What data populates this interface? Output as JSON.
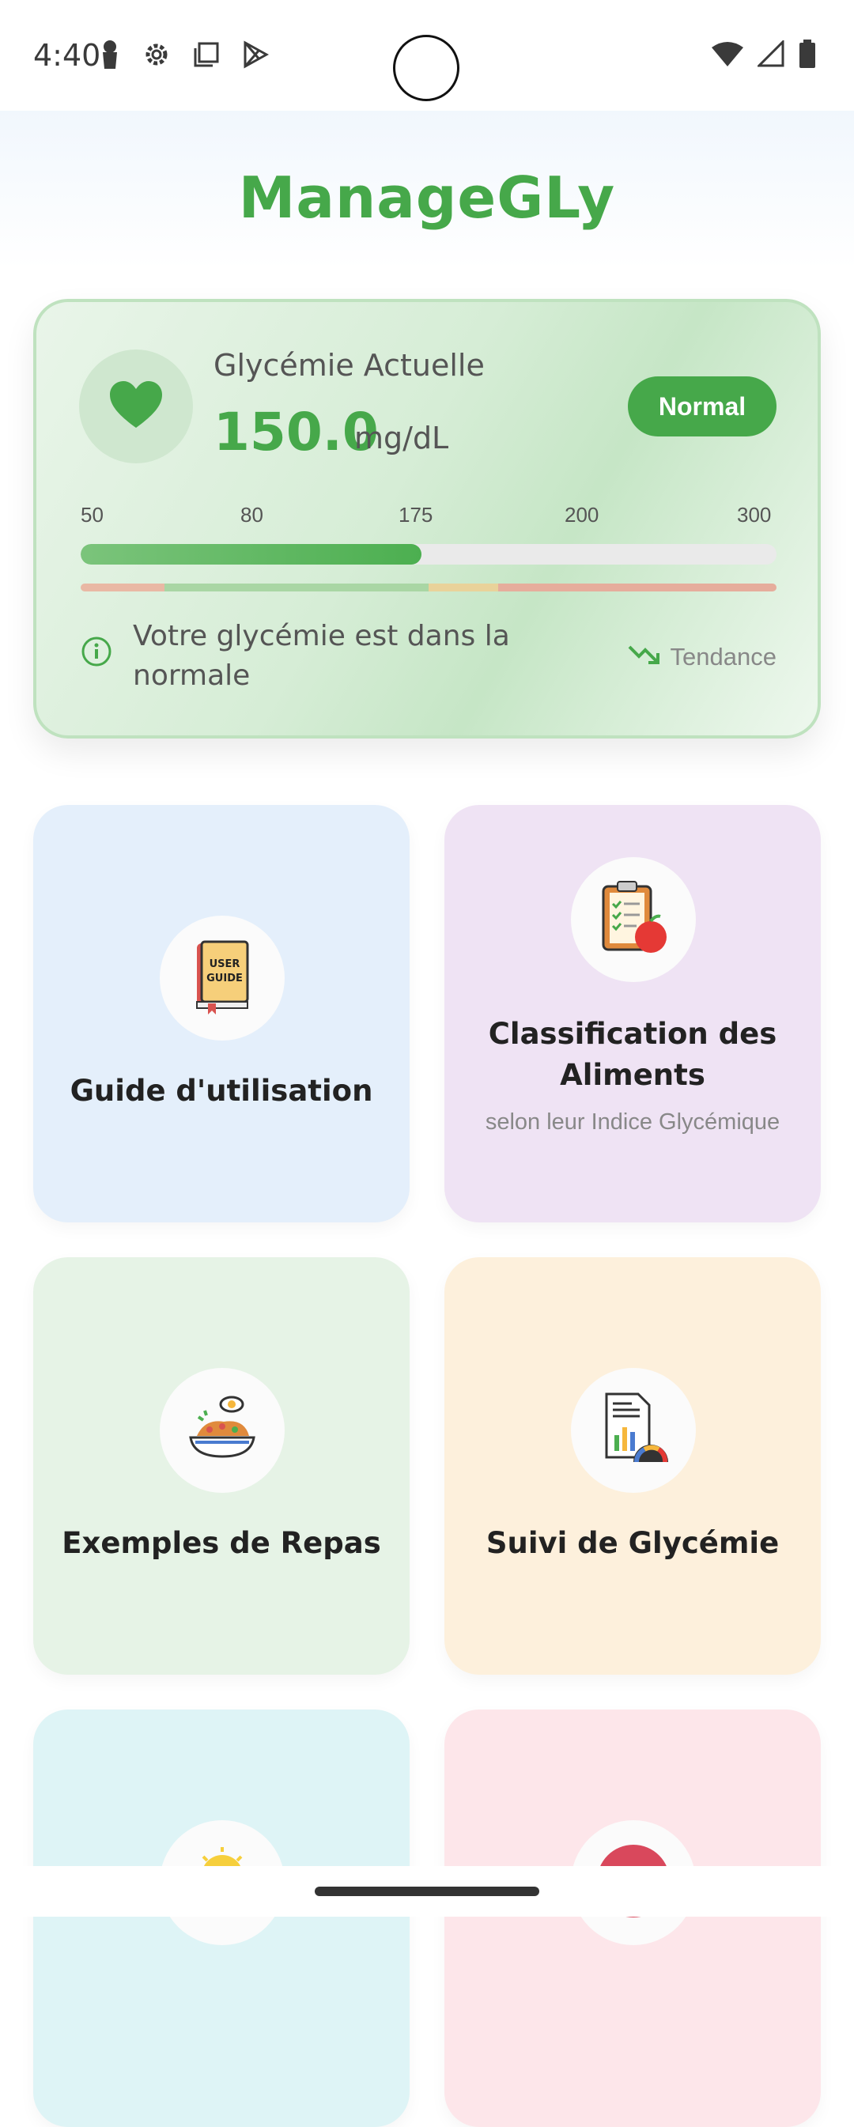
{
  "status_bar": {
    "time": "4:40",
    "left_icons": [
      "lock-icon",
      "gear-icon",
      "window-icon",
      "play-icon"
    ],
    "right_icons": [
      "wifi-icon",
      "signal-icon",
      "battery-icon"
    ]
  },
  "app": {
    "title": "ManageGLy"
  },
  "glycemia": {
    "label": "Glycémie Actuelle",
    "value": "150.0",
    "unit": "mg/dL",
    "status": "Normal",
    "scale_ticks": [
      "50",
      "80",
      "175",
      "200",
      "300"
    ],
    "level_fraction": 0.49,
    "message": "Votre glycémie est dans la normale",
    "trend_label": "Tendance",
    "accent_color": "#46a84a"
  },
  "tiles": [
    {
      "title": "Guide d'utilisation",
      "subtitle": "",
      "icon": "user-guide-book-icon",
      "color": "#e4effb"
    },
    {
      "title": "Classification des Aliments",
      "subtitle": "selon leur Indice Glycémique",
      "icon": "clipboard-apple-icon",
      "color": "#efe3f4"
    },
    {
      "title": "Exemples de Repas",
      "subtitle": "",
      "icon": "meal-bowl-icon",
      "color": "#e6f3e6"
    },
    {
      "title": "Suivi de Glycémie",
      "subtitle": "",
      "icon": "report-gauge-icon",
      "color": "#fdf0dc"
    },
    {
      "title": "",
      "subtitle": "",
      "icon": "lightbulb-icon",
      "color": "#def4f6"
    },
    {
      "title": "",
      "subtitle": "",
      "icon": "alert-icon",
      "color": "#fde6ea"
    }
  ]
}
